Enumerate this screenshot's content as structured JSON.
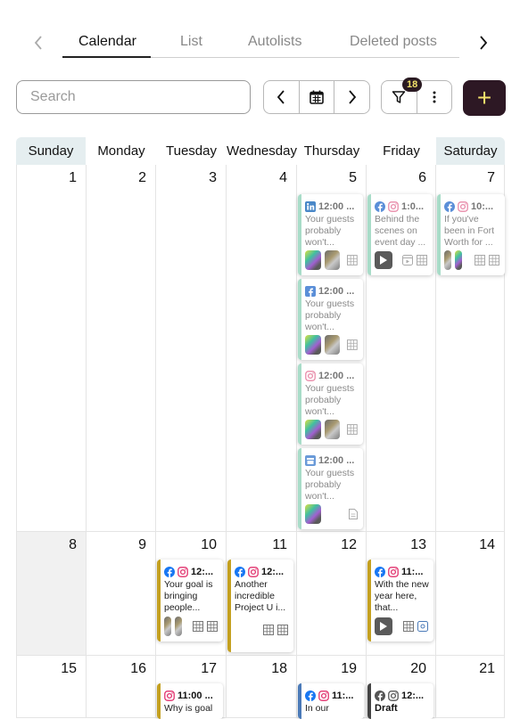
{
  "tabs": {
    "items": [
      "Calendar",
      "List",
      "Autolists",
      "Deleted posts"
    ],
    "active": "Calendar"
  },
  "toolbar": {
    "search_placeholder": "Search",
    "filter_count": "18",
    "add_label": "+"
  },
  "calendar": {
    "days": [
      "Sunday",
      "Monday",
      "Tuesday",
      "Wednesday",
      "Thursday",
      "Friday",
      "Saturday"
    ],
    "weeks": [
      [
        "1",
        "2",
        "3",
        "4",
        "5",
        "6",
        "7"
      ],
      [
        "8",
        "9",
        "10",
        "11",
        "12",
        "13",
        "14"
      ],
      [
        "15",
        "16",
        "17",
        "18",
        "19",
        "20",
        "21"
      ]
    ]
  },
  "posts": {
    "thu5_a": {
      "time": "12:00 ...",
      "text": "Your guests probably won't..."
    },
    "thu5_b": {
      "time": "12:00 ...",
      "text": "Your guests probably won't..."
    },
    "thu5_c": {
      "time": "12:00 ...",
      "text": "Your guests probably won't..."
    },
    "thu5_d": {
      "time": "12:00 ...",
      "text": "Your guests probably won't..."
    },
    "fri6": {
      "time": "1:0...",
      "text": "Behind the scenes on event day ..."
    },
    "sat7": {
      "time": "10:...",
      "text": "If you've been in Fort Worth for ..."
    },
    "tue10": {
      "time": "12:...",
      "text": "Your goal is bringing people..."
    },
    "wed11": {
      "time": "12:...",
      "text": "Another incredible Project U i..."
    },
    "fri13": {
      "time": "11:...",
      "text": "With the new year here, that..."
    },
    "tue17": {
      "time": "11:00 ...",
      "text": "Why is goal"
    },
    "thu19": {
      "time": "11:...",
      "text": "In our"
    },
    "fri20": {
      "time": "12:...",
      "text": "Draft"
    }
  },
  "colors": {
    "published": "#a8dcc8",
    "scheduled": "#c4a020",
    "blue_strip": "#4a7ab8",
    "draft_strip": "#444444",
    "facebook": "#1877f2",
    "instagram": "#e1306c",
    "linkedin": "#0a66c2",
    "accent": "#2d1824",
    "accent_text": "#f3e26b"
  }
}
